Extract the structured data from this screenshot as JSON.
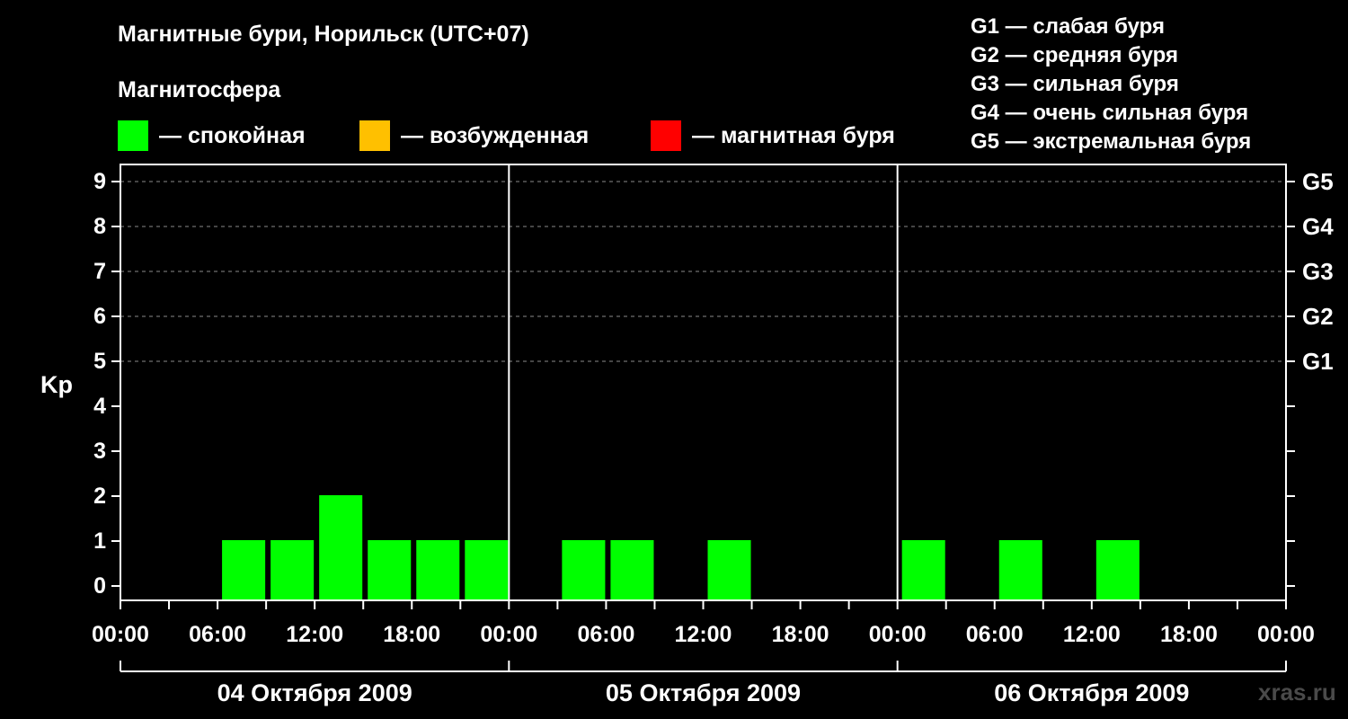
{
  "header": {
    "title": "Магнитные бури, Норильск (UTC+07)",
    "subtitle": "Магнитосфера"
  },
  "legend": [
    {
      "label": "— спокойная",
      "color": "#00ff00"
    },
    {
      "label": "— возбужденная",
      "color": "#ffc000"
    },
    {
      "label": "— магнитная буря",
      "color": "#ff0000"
    }
  ],
  "g_legend": [
    "G1 — слабая буря",
    "G2 — средняя буря",
    "G3 — сильная буря",
    "G4 — очень сильная буря",
    "G5 — экстремальная буря"
  ],
  "watermark": "xras.ru",
  "chart_data": {
    "type": "bar",
    "ylabel": "Kp",
    "ylim": [
      0,
      9
    ],
    "y_ticks": [
      "0",
      "1",
      "2",
      "3",
      "4",
      "5",
      "6",
      "7",
      "8",
      "9"
    ],
    "g_ticks": [
      {
        "kp": 5,
        "label": "G1"
      },
      {
        "kp": 6,
        "label": "G2"
      },
      {
        "kp": 7,
        "label": "G3"
      },
      {
        "kp": 8,
        "label": "G4"
      },
      {
        "kp": 9,
        "label": "G5"
      }
    ],
    "grid": "dashed horizontal at Kp 5–9",
    "x_tick_labels": [
      "00:00",
      "06:00",
      "12:00",
      "18:00",
      "00:00",
      "06:00",
      "12:00",
      "18:00",
      "00:00",
      "06:00",
      "12:00",
      "18:00",
      "00:00"
    ],
    "days": [
      "04 Октября 2009",
      "05 Октября 2009",
      "06 Октября 2009"
    ],
    "interval_hours": 3,
    "colors": {
      "quiet": "#00ff00"
    },
    "bars": [
      {
        "day": "04 Октября 2009",
        "start": "06:00",
        "kp": 1
      },
      {
        "day": "04 Октября 2009",
        "start": "09:00",
        "kp": 1
      },
      {
        "day": "04 Октября 2009",
        "start": "12:00",
        "kp": 2
      },
      {
        "day": "04 Октября 2009",
        "start": "15:00",
        "kp": 1
      },
      {
        "day": "04 Октября 2009",
        "start": "18:00",
        "kp": 1
      },
      {
        "day": "04 Октября 2009",
        "start": "21:00",
        "kp": 1
      },
      {
        "day": "05 Октября 2009",
        "start": "03:00",
        "kp": 1
      },
      {
        "day": "05 Октября 2009",
        "start": "06:00",
        "kp": 1
      },
      {
        "day": "05 Октября 2009",
        "start": "12:00",
        "kp": 1
      },
      {
        "day": "06 Октября 2009",
        "start": "00:00",
        "kp": 1
      },
      {
        "day": "06 Октября 2009",
        "start": "06:00",
        "kp": 1
      },
      {
        "day": "06 Октября 2009",
        "start": "12:00",
        "kp": 1
      }
    ]
  }
}
